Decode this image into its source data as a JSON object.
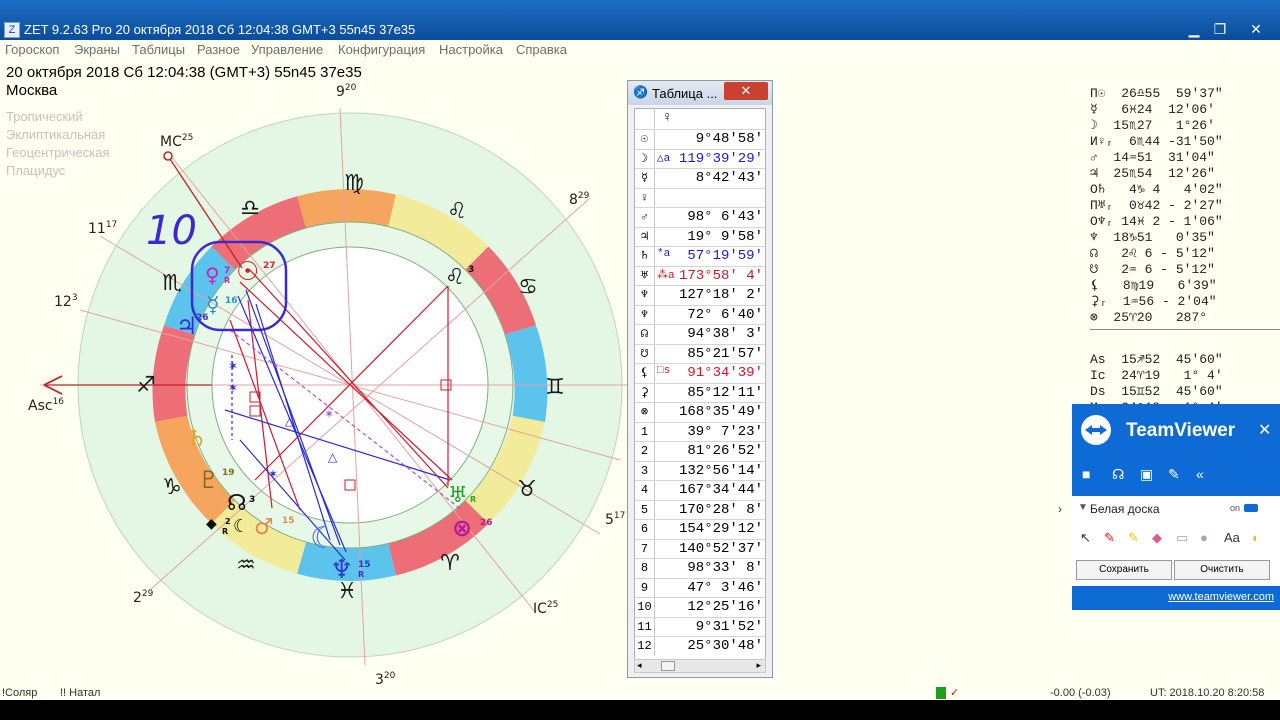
{
  "window": {
    "title": "ZET 9.2.63 Pro   20 октября 2018  Сб  12:04:38 GMT+3 55n45  37e35",
    "minimize": "▁",
    "maximize": "❐",
    "close": "✕"
  },
  "menu": [
    "Гороскоп",
    "Экраны",
    "Таблицы",
    "Разное",
    "Управление",
    "Конфигурация",
    "Настройка",
    "Справка"
  ],
  "info": {
    "line1": "20 октября 2018  Сб  12:04:38 (GMT+3) 55n45  37e35",
    "line2": "Москва",
    "settings": [
      "Тропический",
      "Эклиптикальная",
      "Геоцентрическая",
      "Плацидус"
    ]
  },
  "wheel": {
    "signs": [
      "♎",
      "♏",
      "♐",
      "♑",
      "♒",
      "♓",
      "♈",
      "♉",
      "♊",
      "♋",
      "♌",
      "♍"
    ],
    "cusps": {
      "c9": "9",
      "c9s": "20",
      "mc": "MC",
      "mcs": "25",
      "c11": "11",
      "c11s": "17",
      "c12": "12",
      "c12s": "3",
      "asc": "Asc",
      "ascs": "16",
      "c2": "2",
      "c2s": "29",
      "c3": "3",
      "c3s": "20",
      "ic": "IC",
      "ics": "25",
      "c5": "5",
      "c5s": "17",
      "c8": "8",
      "c8s": "29"
    },
    "annotation": "10",
    "planets": {
      "sun": "☉",
      "sun_deg": "27",
      "venus": "♀",
      "venus_deg": "7",
      "venus_r": "R",
      "mercury": "☿",
      "mercury_deg": "16",
      "jupiter": "♃",
      "jupiter_deg": "26",
      "saturn": "♄",
      "pluto": "♇",
      "pluto_deg": "19",
      "node": "☊",
      "node_deg": "3",
      "moon": "☾",
      "lilith": "☾",
      "lilith_deg": "2",
      "mars": "♂",
      "mars_deg": "15",
      "neptune": "♆",
      "neptune_deg": "15",
      "neptune_r": "R",
      "uranus": "♅",
      "uranus_r": "R",
      "fortuna": "⊗",
      "fortuna_deg": "26",
      "leo_node": "♌",
      "leo_deg": "3",
      "star": "◆",
      "star_r": "R"
    }
  },
  "table": {
    "title": "Таблица ...",
    "close": "✕",
    "header": "♀",
    "rows": [
      {
        "g": "☉",
        "f": "",
        "v": "9°48'58'",
        "c": "#000000"
      },
      {
        "g": "☽",
        "f": "△a",
        "v": "119°39'29'",
        "c": "#1a1ad6"
      },
      {
        "g": "☿",
        "f": "",
        "v": "8°42'43'",
        "c": "#000000"
      },
      {
        "g": "♀",
        "f": "",
        "v": "",
        "c": "#000000"
      },
      {
        "g": "♂",
        "f": "",
        "v": "98° 6'43'",
        "c": "#000000"
      },
      {
        "g": "♃",
        "f": "",
        "v": "19° 9'58'",
        "c": "#000000"
      },
      {
        "g": "♄",
        "f": "*a",
        "v": "57°19'59'",
        "c": "#1a1ad6"
      },
      {
        "g": "♅",
        "f": "⁂a",
        "v": "173°58' 4'",
        "c": "#d4142a"
      },
      {
        "g": "♆",
        "f": "",
        "v": "127°18' 2'",
        "c": "#000000"
      },
      {
        "g": "♆",
        "f": "",
        "v": "72° 6'40'",
        "c": "#000000"
      },
      {
        "g": "☊",
        "f": "",
        "v": "94°38' 3'",
        "c": "#000000"
      },
      {
        "g": "☋",
        "f": "",
        "v": "85°21'57'",
        "c": "#000000"
      },
      {
        "g": "⚸",
        "f": "□s",
        "v": "91°34'39'",
        "c": "#d4142a"
      },
      {
        "g": "⚳",
        "f": "",
        "v": "85°12'11'",
        "c": "#000000"
      },
      {
        "g": "⊗",
        "f": "",
        "v": "168°35'49'",
        "c": "#000000"
      },
      {
        "g": "1",
        "f": "",
        "v": "39° 7'23'",
        "c": "#000000"
      },
      {
        "g": "2",
        "f": "",
        "v": "81°26'52'",
        "c": "#000000"
      },
      {
        "g": "3",
        "f": "",
        "v": "132°56'14'",
        "c": "#000000"
      },
      {
        "g": "4",
        "f": "",
        "v": "167°34'44'",
        "c": "#000000"
      },
      {
        "g": "5",
        "f": "",
        "v": "170°28' 8'",
        "c": "#000000"
      },
      {
        "g": "6",
        "f": "",
        "v": "154°29'12'",
        "c": "#000000"
      },
      {
        "g": "7",
        "f": "",
        "v": "140°52'37'",
        "c": "#000000"
      },
      {
        "g": "8",
        "f": "",
        "v": "98°33' 8'",
        "c": "#000000"
      },
      {
        "g": "9",
        "f": "",
        "v": "47° 3'46'",
        "c": "#000000"
      },
      {
        "g": "10",
        "f": "",
        "v": "12°25'16'",
        "c": "#000000"
      },
      {
        "g": "11",
        "f": "",
        "v": "9°31'52'",
        "c": "#000000"
      },
      {
        "g": "12",
        "f": "",
        "v": "25°30'48'",
        "c": "#000000"
      }
    ]
  },
  "positions": [
    "П☉  26♎55  59'37\"",
    "☿   6♓24  12'06'",
    "☽  15♏27   1°26'",
    "И♀ᵣ  6♏44 -31'50\"",
    "♂  14♒51  31'04\"",
    "♃  25♏54  12'26\"",
    "О♄   4♑ 4   4'02\"",
    "П♅ᵣ  0♉42 - 2'27\"",
    "О♆ᵣ 14♓ 2 - 1'06\"",
    "♆  18♑51   0'35\"",
    "☊   2♌ 6 - 5'12\"",
    "☋   2♒ 6 - 5'12\"",
    "⚸   8♍19   6'39\"",
    "⚳ᵣ  1♒56 - 2'04\"",
    "⊗  25♈20   287°",
    "",
    "As  15♐52  45'60\"",
    "Ic  24♈19   1° 4'",
    "Ds  15♊52  45'60\"",
    "Mc  24♎19   1° 4'"
  ],
  "teamviewer": {
    "name": "TeamViewer",
    "close": "✕",
    "whiteboard": "Белая доска",
    "on": "on",
    "save": "Сохранить",
    "clear": "Очистить",
    "link": "www.teamviewer.com"
  },
  "status": {
    "mode1": "!Соляр",
    "mode2": "!! Натал",
    "offset": "-0.00 (-0.03)",
    "ut": "UT: 2018.10.20  8:20:58"
  }
}
